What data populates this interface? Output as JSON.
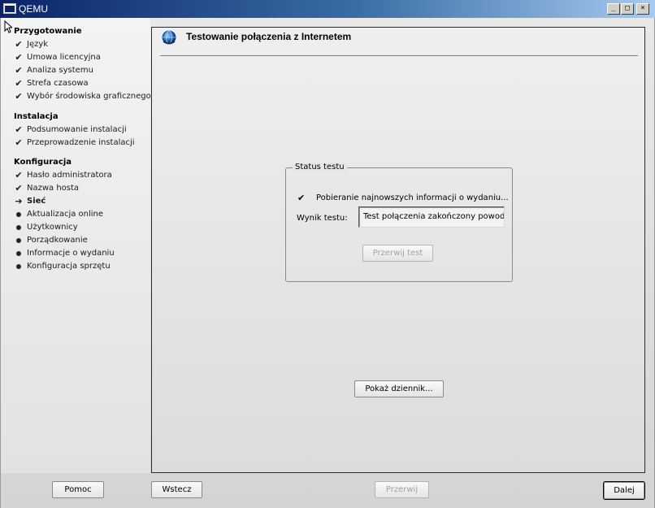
{
  "window": {
    "title": "QEMU",
    "min_glyph": "_",
    "max_glyph": "□",
    "close_glyph": "×"
  },
  "sidebar": {
    "sections": [
      {
        "heading": "Przygotowanie",
        "steps": [
          {
            "label": "Język",
            "state": "done"
          },
          {
            "label": "Umowa licencyjna",
            "state": "done"
          },
          {
            "label": "Analiza systemu",
            "state": "done"
          },
          {
            "label": "Strefa czasowa",
            "state": "done"
          },
          {
            "label": "Wybór środowiska graficznego",
            "state": "done"
          }
        ]
      },
      {
        "heading": "Instalacja",
        "steps": [
          {
            "label": "Podsumowanie instalacji",
            "state": "done"
          },
          {
            "label": "Przeprowadzenie instalacji",
            "state": "done"
          }
        ]
      },
      {
        "heading": "Konfiguracja",
        "steps": [
          {
            "label": "Hasło administratora",
            "state": "done"
          },
          {
            "label": "Nazwa hosta",
            "state": "done"
          },
          {
            "label": "Sieć",
            "state": "current"
          },
          {
            "label": "Aktualizacja online",
            "state": "pending"
          },
          {
            "label": "Użytkownicy",
            "state": "pending"
          },
          {
            "label": "Porządkowanie",
            "state": "pending"
          },
          {
            "label": "Informacje o wydaniu",
            "state": "pending"
          },
          {
            "label": "Konfiguracja sprzętu",
            "state": "pending"
          }
        ]
      }
    ],
    "marks": {
      "done": "✔",
      "current": "➔"
    }
  },
  "panel": {
    "title": "Testowanie połączenia z Internetem",
    "status_group": {
      "legend": "Status testu",
      "check_mark": "✔",
      "status_line": "Pobieranie najnowszych informacji o wydaniu...",
      "result_label": "Wynik testu:",
      "result_value": "Test połączenia zakończony powodzeniem",
      "abort_label": "Przerwij test"
    },
    "log_button": "Pokaż dziennik..."
  },
  "footer": {
    "help": "Pomoc",
    "back": "Wstecz",
    "abort": "Przerwij",
    "next": "Dalej"
  },
  "colors": {
    "titlebar_start": "#0a246a",
    "titlebar_end": "#a6caf0",
    "disabled_text": "#a0a0a0"
  },
  "icons": {
    "window": "qemu-window-icon",
    "cursor": "mouse-pointer-icon",
    "page": "globe-network-icon"
  }
}
